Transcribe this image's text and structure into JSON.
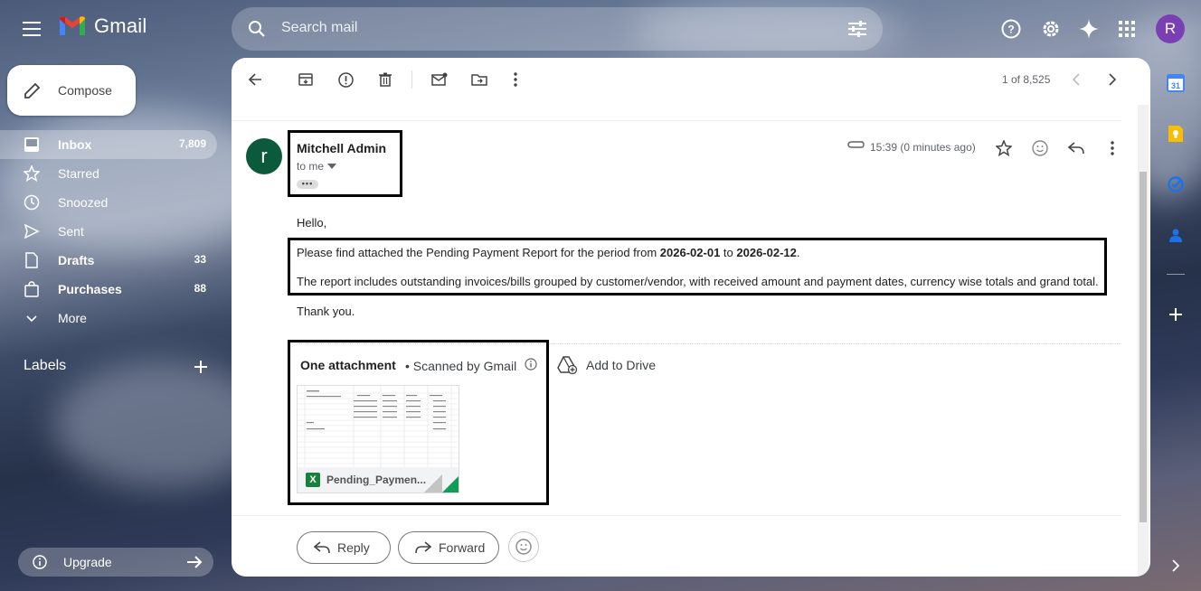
{
  "header": {
    "app_name": "Gmail",
    "search_placeholder": "Search mail",
    "avatar_letter": "R"
  },
  "compose_label": "Compose",
  "nav": [
    {
      "label": "Inbox",
      "count": "7,809",
      "icon": "inbox-icon",
      "active": true
    },
    {
      "label": "Starred",
      "count": "",
      "icon": "star-icon"
    },
    {
      "label": "Snoozed",
      "count": "",
      "icon": "clock-icon"
    },
    {
      "label": "Sent",
      "count": "",
      "icon": "send-icon"
    },
    {
      "label": "Drafts",
      "count": "33",
      "icon": "draft-icon"
    },
    {
      "label": "Purchases",
      "count": "88",
      "icon": "tag-icon"
    },
    {
      "label": "More",
      "count": "",
      "icon": "chevron-down-icon"
    }
  ],
  "labels_title": "Labels",
  "upgrade_label": "Upgrade",
  "toolbar": {
    "pager": "1 of 8,525"
  },
  "message": {
    "avatar_letter": "r",
    "sender": "Mitchell Admin",
    "to": "to me",
    "ellipsis": "•••",
    "time": "15:39 (0 minutes ago)",
    "greeting": "Hello,",
    "para1_prefix": "Please find attached the Pending Payment Report for the period from ",
    "date_from": "2026-02-01",
    "para1_mid": " to ",
    "date_to": "2026-02-12",
    "para1_suffix": ".",
    "para2": "The report includes outstanding invoices/bills grouped by customer/vendor, with received amount and payment dates, currency wise totals and grand total.",
    "closing": "Thank you."
  },
  "attachments": {
    "title": "One attachment",
    "scanned": "•  Scanned by Gmail",
    "add_to_drive": "Add to Drive",
    "file_name": "Pending_Paymen...",
    "file_type_letter": "X"
  },
  "actions": {
    "reply": "Reply",
    "forward": "Forward"
  },
  "side_calendar_number": "31"
}
